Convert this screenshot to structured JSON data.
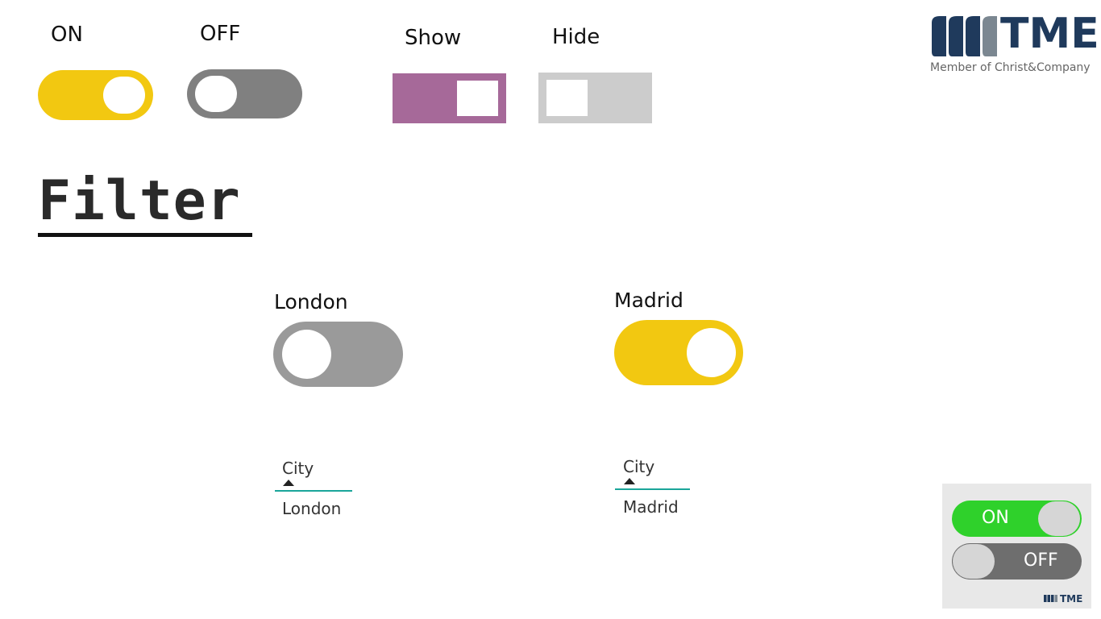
{
  "top_toggles": {
    "on_label": "ON",
    "off_label": "OFF",
    "show_label": "Show",
    "hide_label": "Hide"
  },
  "filter": {
    "title": "Filter"
  },
  "cities": [
    {
      "toggle_label": "London",
      "state": "off",
      "field_label": "City",
      "field_value": "London"
    },
    {
      "toggle_label": "Madrid",
      "state": "on",
      "field_label": "City",
      "field_value": "Madrid"
    }
  ],
  "logo": {
    "wordmark": "TME",
    "tagline": "Member of Christ&Company"
  },
  "corner_widget": {
    "on_text": "ON",
    "off_text": "OFF",
    "brand": "TME"
  },
  "colors": {
    "yellow": "#f2c811",
    "dark_gray": "#808080",
    "mid_gray": "#9a9a9a",
    "purple": "#a66999",
    "light_gray": "#cccccc",
    "green": "#2fd12b",
    "teal": "#1aa59a",
    "navy": "#1f3a5c"
  }
}
